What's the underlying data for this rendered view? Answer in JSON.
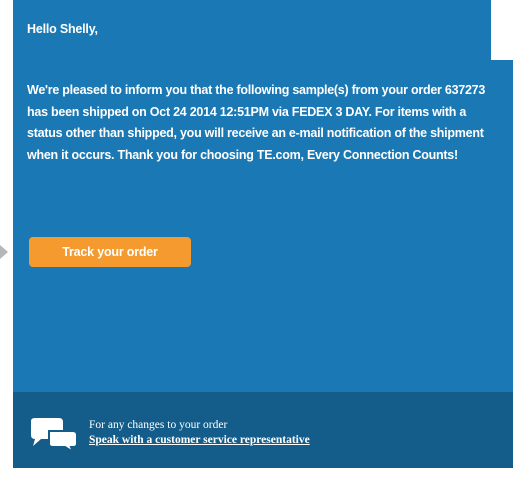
{
  "email": {
    "greeting": "Hello Shelly,",
    "message": "We're pleased to inform you that the following sample(s) from your order 637273 has been shipped on Oct 24 2014 12:51PM via FEDEX 3 DAY. For items with a status other than shipped, you will receive an e-mail notification of the shipment when it occurs. Thank you for choosing TE.com, Every Connection Counts!",
    "track_button": "Track your order"
  },
  "footer": {
    "caption": "For any changes to your order",
    "link": "Speak with a customer service representative",
    "icon": "chat-bubbles-icon"
  },
  "colors": {
    "main_background": "#1a78b4",
    "footer_background": "#145d8a",
    "button": "#f59a2e",
    "text": "#ffffff"
  }
}
